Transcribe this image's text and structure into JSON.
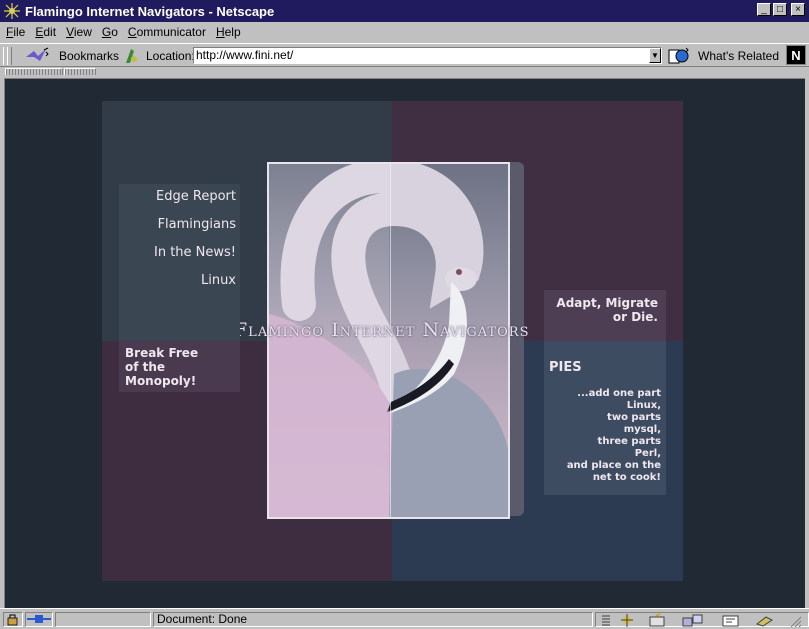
{
  "window": {
    "title": "Flamingo Internet Navigators - Netscape",
    "minimize": "_",
    "maximize": "□",
    "close": "×"
  },
  "menu": [
    "File",
    "Edit",
    "View",
    "Go",
    "Communicator",
    "Help"
  ],
  "toolbar": {
    "bookmarks_label": "Bookmarks",
    "location_label": "Location:",
    "location_value": "http://www.fini.net/",
    "related_label": "What's Related",
    "logo": "N"
  },
  "page": {
    "site_title": "Flamingo Internet Navigators",
    "nav": [
      "Edge Report",
      "Flamingians",
      "In the News!",
      "Linux"
    ],
    "break_free": "Break Free\nof the\nMonopoly!",
    "adapt": "Adapt, Migrate\nor Die.",
    "pies_title": "PIES",
    "pies_text": "...add one part\nLinux,\ntwo parts\nmysql,\nthree parts\nPerl,\nand place on the\nnet to cook!"
  },
  "status": {
    "text": "Document: Done"
  }
}
